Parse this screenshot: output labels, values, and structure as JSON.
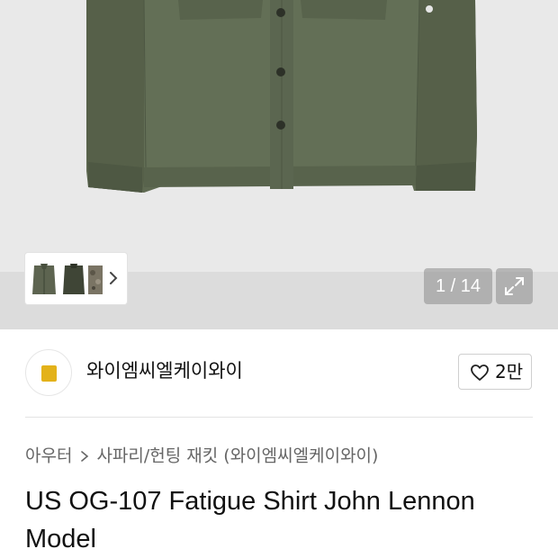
{
  "gallery": {
    "counter": "1 / 14",
    "thumbnails": [
      "product-front-thumbnail",
      "product-back-thumbnail",
      "product-detail-thumbnail"
    ],
    "next_icon": "chevron-right-icon",
    "expand_icon": "expand-icon"
  },
  "brand": {
    "name": "와이엠씨엘케이와이",
    "likes": "2만",
    "like_icon": "heart-icon"
  },
  "breadcrumb": {
    "category": "아우터",
    "subcategory": "사파리/헌팅 재킷 (와이엠씨엘케이와이)"
  },
  "product": {
    "title": "US OG-107 Fatigue Shirt John Lennon Model"
  },
  "colors": {
    "jacket": "#5f6a52",
    "hero_bg": "#e9e9e9",
    "logo": "#e3b21a"
  }
}
